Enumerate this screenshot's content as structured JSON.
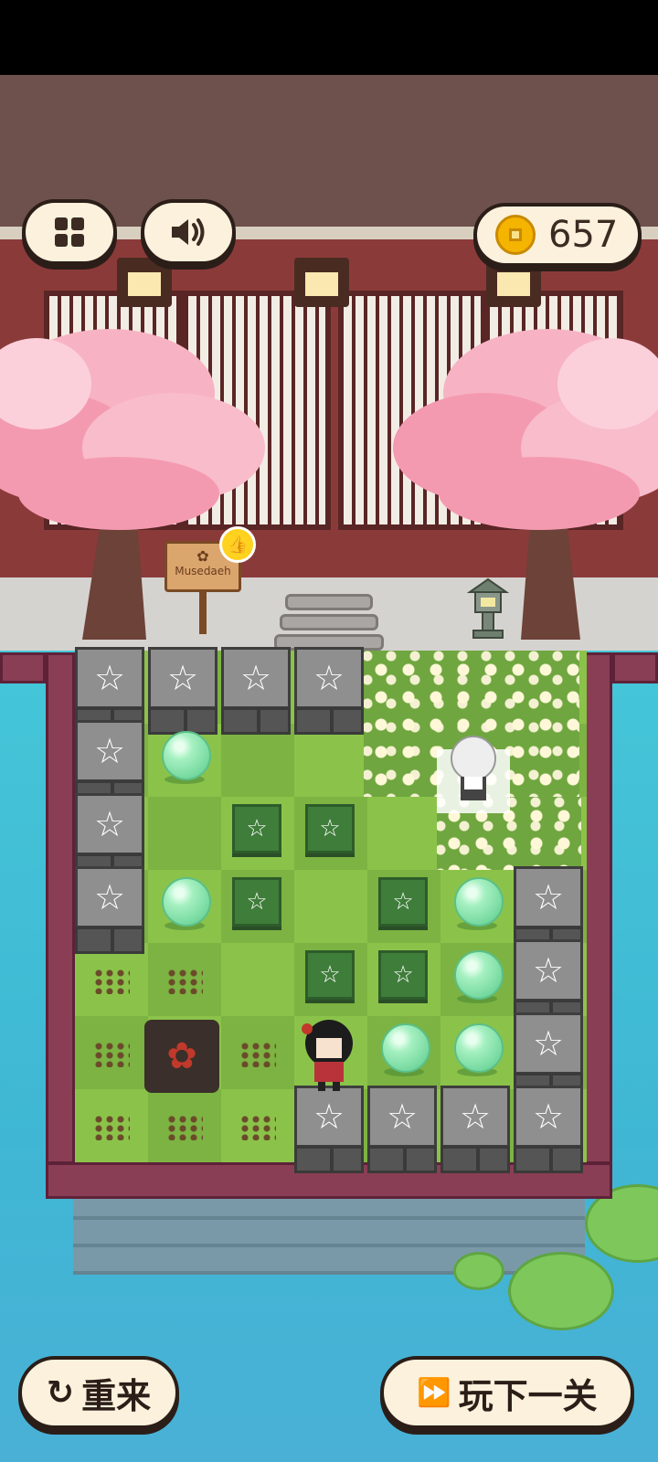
{
  "hud": {
    "menu_icon": "grid-menu-icon",
    "sound_icon": "speaker-icon",
    "coin_icon": "coin-icon",
    "coin_count": "657"
  },
  "scene": {
    "sign_text": "Musedaeh",
    "sign_badge_icon": "thumbs-up-icon"
  },
  "board": {
    "stone_symbol": "☆",
    "tile_symbol": "☆",
    "hole_symbol": "✿"
  },
  "buttons": {
    "restart_icon": "restart-icon",
    "restart_label": "重来",
    "next_icon": "fast-forward-icon",
    "next_label": "玩下一关"
  },
  "colors": {
    "grass_light": "#8bc34a",
    "grass_dark": "#7cb342",
    "fence": "#8a3e55",
    "button_bg": "#fbf1dc",
    "coin": "#f4b400"
  }
}
